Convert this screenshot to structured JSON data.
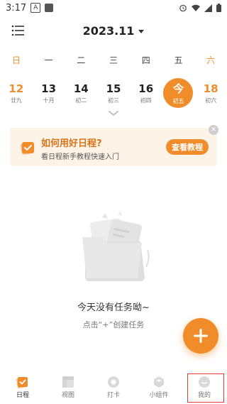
{
  "status_bar": {
    "time": "3:17",
    "notif_letter": "A"
  },
  "header": {
    "title": "2023.11",
    "menu_icon": "menu-icon",
    "dropdown_icon": "chevron-down-icon"
  },
  "weekdays": [
    "日",
    "一",
    "二",
    "三",
    "四",
    "五",
    "六"
  ],
  "dates": [
    {
      "day": "12",
      "lunar": "廿九"
    },
    {
      "day": "13",
      "lunar": "十月"
    },
    {
      "day": "14",
      "lunar": "初二"
    },
    {
      "day": "15",
      "lunar": "初三"
    },
    {
      "day": "16",
      "lunar": "初四"
    },
    {
      "day": "今",
      "lunar": "初五"
    },
    {
      "day": "18",
      "lunar": "初六"
    }
  ],
  "banner": {
    "title": "如何用好日程?",
    "subtitle": "看日程新手教程快速入门",
    "button": "查看教程"
  },
  "empty": {
    "title": "今天没有任务呦~",
    "subtitle": "点击“+”创建任务"
  },
  "tabs": [
    {
      "label": "日程"
    },
    {
      "label": "视图"
    },
    {
      "label": "打卡"
    },
    {
      "label": "小组件"
    },
    {
      "label": "我的"
    }
  ],
  "colors": {
    "accent": "#f08c2a",
    "banner_bg": "#fdf3e7",
    "highlight": "#e53935"
  }
}
